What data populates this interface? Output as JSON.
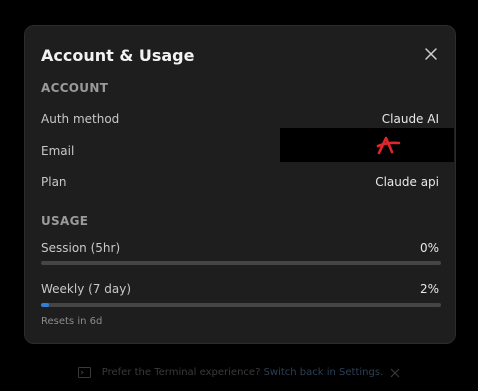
{
  "dialog": {
    "title": "Account & Usage",
    "close_icon": "close-icon"
  },
  "account": {
    "section_label": "ACCOUNT",
    "auth_method_label": "Auth method",
    "auth_method_value": "Claude AI",
    "email_label": "Email",
    "email_value_redacted": true,
    "plan_label": "Plan",
    "plan_value": "Claude api"
  },
  "usage": {
    "section_label": "USAGE",
    "session_label": "Session (5hr)",
    "session_percent_text": "0%",
    "session_fraction": 0.0,
    "weekly_label": "Weekly (7 day)",
    "weekly_percent_text": "2%",
    "weekly_fraction": 0.02,
    "resets_text": "Resets in 6d"
  },
  "footer": {
    "icon": "terminal-icon",
    "prompt_text": "Prefer the Terminal experience?",
    "link_text": "Switch back in Settings.",
    "dismiss_icon": "close-icon"
  },
  "colors": {
    "dialog_bg": "#1e1e1e",
    "progress_fill": "#2f7fd8",
    "progress_track": "#454545",
    "redaction_mark": "#e0262a"
  }
}
